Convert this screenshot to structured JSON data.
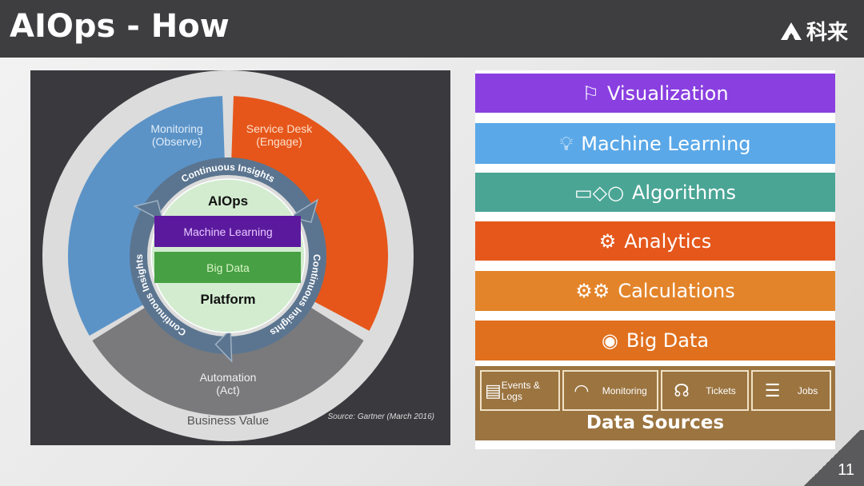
{
  "header": {
    "title": "AIOps - How",
    "logo_text": "科来"
  },
  "left_diagram": {
    "segments": [
      {
        "label": "Monitoring",
        "sub": "(Observe)",
        "color": "#5b93c7"
      },
      {
        "label": "Service Desk",
        "sub": "(Engage)",
        "color": "#e6561a"
      },
      {
        "label": "Automation",
        "sub": "(Act)",
        "color": "#7a7a7c"
      }
    ],
    "ring_label": "Continuous Insights",
    "core_title": "AIOps",
    "core_layers": [
      {
        "label": "Machine Learning",
        "color": "#5b1a9e"
      },
      {
        "label": "Big Data",
        "color": "#47a043"
      }
    ],
    "core_footer": "Platform",
    "outer_label": "Business Value",
    "source": "Source: Gartner (March 2016)"
  },
  "right_stack": {
    "layers": [
      {
        "label": "Visualization",
        "icon": "presentation-icon",
        "color": "#8a3fe0"
      },
      {
        "label": "Machine Learning",
        "icon": "lightbulb-icon",
        "color": "#5aa8e8"
      },
      {
        "label": "Algorithms",
        "icon": "flowchart-icon",
        "color": "#4aa595"
      },
      {
        "label": "Analytics",
        "icon": "code-gear-icon",
        "color": "#e5571b"
      },
      {
        "label": "Calculations",
        "icon": "gears-icon",
        "color": "#e3842a"
      },
      {
        "label": "Big Data",
        "icon": "disk-icon",
        "color": "#e0701e"
      }
    ],
    "data_sources": {
      "label": "Data Sources",
      "color": "#9b7440",
      "items": [
        {
          "label": "Events & Logs",
          "icon": "window-icon"
        },
        {
          "label": "Monitoring",
          "icon": "gauge-icon"
        },
        {
          "label": "Tickets",
          "icon": "headset-icon"
        },
        {
          "label": "Jobs",
          "icon": "database-icon"
        }
      ]
    }
  },
  "page_number": "11"
}
